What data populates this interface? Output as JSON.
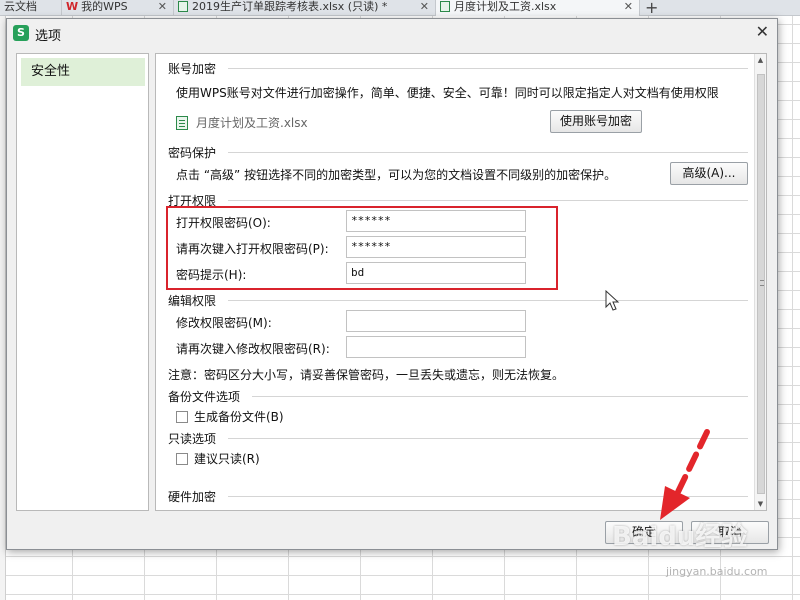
{
  "browser_tabs": [
    {
      "label": "云文档"
    },
    {
      "label": "我的WPS"
    },
    {
      "label": "2019生产订单跟踪考核表.xlsx (只读) *"
    },
    {
      "label": "月度计划及工资.xlsx"
    }
  ],
  "dialog": {
    "title": "选项",
    "app_icon_letter": "S",
    "close_glyph": "✕"
  },
  "nav": {
    "items": [
      {
        "label": "安全性"
      }
    ]
  },
  "account_encrypt": {
    "title": "账号加密",
    "description": "使用WPS账号对文件进行加密操作，简单、便捷、安全、可靠！同时可以限定指定人对文档有使用权限",
    "file_name": "月度计划及工资.xlsx",
    "button_label": "使用账号加密"
  },
  "password_protect": {
    "title": "密码保护",
    "description": "点击 “高级” 按钮选择不同的加密类型，可以为您的文档设置不同级别的加密保护。",
    "advanced_button": "高级(A)..."
  },
  "open_permission": {
    "title": "打开权限",
    "password_label": "打开权限密码(O):",
    "password_value": "******",
    "confirm_label": "请再次键入打开权限密码(P):",
    "confirm_value": "******",
    "hint_label": "密码提示(H):",
    "hint_value": "bd"
  },
  "edit_permission": {
    "title": "编辑权限",
    "password_label": "修改权限密码(M):",
    "password_value": "",
    "confirm_label": "请再次键入修改权限密码(R):",
    "confirm_value": ""
  },
  "notice": "注意：密码区分大小写，请妥善保管密码，一旦丢失或遗忘，则无法恢复。",
  "backup": {
    "title": "备份文件选项",
    "checkbox_label": "生成备份文件(B)"
  },
  "readonly": {
    "title": "只读选项",
    "checkbox_label": "建议只读(R)"
  },
  "hardware": {
    "title": "硬件加密"
  },
  "footer": {
    "ok_label": "确定",
    "cancel_label": "取消"
  },
  "watermark": {
    "text": "Baidu经验",
    "sub": "jingyan.baidu.com"
  },
  "colors": {
    "highlight_red": "#d9232c",
    "nav_selected": "#dff0d8"
  }
}
